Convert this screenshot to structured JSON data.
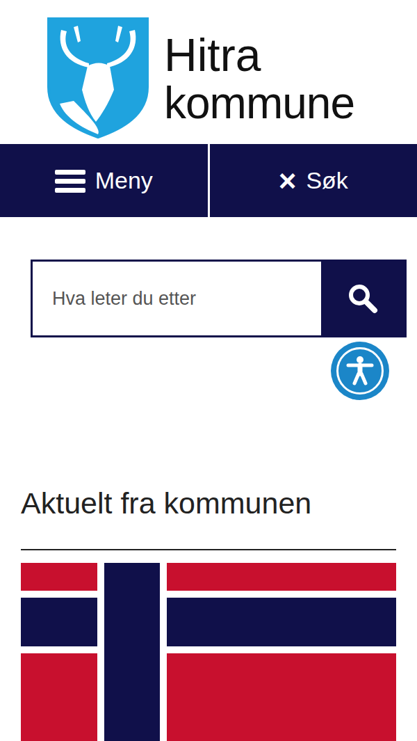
{
  "logo": {
    "name": "Hitra",
    "subtitle": "kommune"
  },
  "nav": [
    {
      "label": "Meny",
      "expanded": false,
      "icon": ""
    },
    {
      "label": "Søk",
      "expanded": true,
      "icon": "×"
    }
  ],
  "search": {
    "placeholder": "Hva leter du etter"
  },
  "news": {
    "heading": "Aktuelt fra kommunen"
  }
}
